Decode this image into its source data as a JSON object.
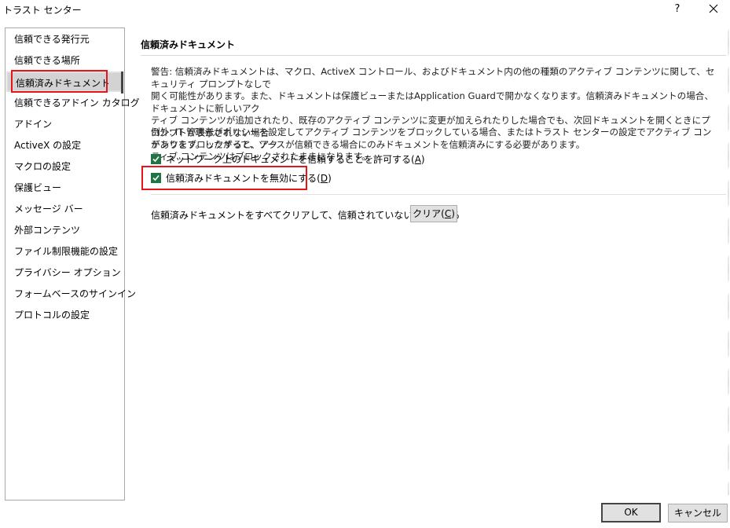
{
  "window": {
    "title": "トラスト センター",
    "help_label": "?",
    "close_icon": "close-icon"
  },
  "sidebar": {
    "items": [
      {
        "label": "信頼できる発行元"
      },
      {
        "label": "信頼できる場所"
      },
      {
        "label": "信頼済みドキュメント",
        "selected": true
      },
      {
        "label": "信頼できるアドイン カタログ"
      },
      {
        "label": "アドイン"
      },
      {
        "label": "ActiveX の設定"
      },
      {
        "label": "マクロの設定"
      },
      {
        "label": "保護ビュー"
      },
      {
        "label": "メッセージ バー"
      },
      {
        "label": "外部コンテンツ"
      },
      {
        "label": "ファイル制限機能の設定"
      },
      {
        "label": "プライバシー オプション"
      },
      {
        "label": "フォームベースのサインイン"
      },
      {
        "label": "プロトコルの設定"
      }
    ]
  },
  "main": {
    "section_title": "信頼済みドキュメント",
    "warning_lines": [
      "警告: 信頼済みドキュメントは、マクロ、ActiveX コントロール、およびドキュメント内の他の種類のアクティブ コンテンツに関して、セキュリティ プロンプトなしで",
      "開く可能性があります。また、ドキュメントは保護ビューまたはApplication Guardで開かなくなります。信頼済みドキュメントの場合、ドキュメントに新しいアク",
      "ティブ コンテンツが追加されたり、既存のアクティブ コンテンツに変更が加えられたりした場合でも、次回ドキュメントを開くときにプロンプトが表示されない場合",
      "があります。したがって、ソースが信頼できる場合にのみドキュメントを信頼済みにする必要があります。"
    ],
    "exception_lines": [
      "例外: IT 管理者がポリシーを設定してアクティブ コンテンツをブロックしている場合、またはトラスト センターの設定でアクティブ コンテンツをブロックすると、アク",
      "ティブ コンテンツはブロックされたままになります。"
    ],
    "checkbox_network": {
      "label": "ネットワーク上のドキュメントを信頼することを許可する",
      "accel": "A",
      "checked": true
    },
    "checkbox_disable": {
      "label": "信頼済みドキュメントを無効にする",
      "accel": "D",
      "checked": true
    },
    "clear_text": "信頼済みドキュメントをすべてクリアして、信頼されていない状態にする",
    "clear_button": {
      "label": "クリア",
      "accel": "C"
    }
  },
  "footer": {
    "ok_label": "OK",
    "cancel_label": "キャンセル"
  },
  "colors": {
    "checkbox_green": "#217346",
    "highlight_red": "#e8141b",
    "selected_bg": "#d3d3d3"
  }
}
